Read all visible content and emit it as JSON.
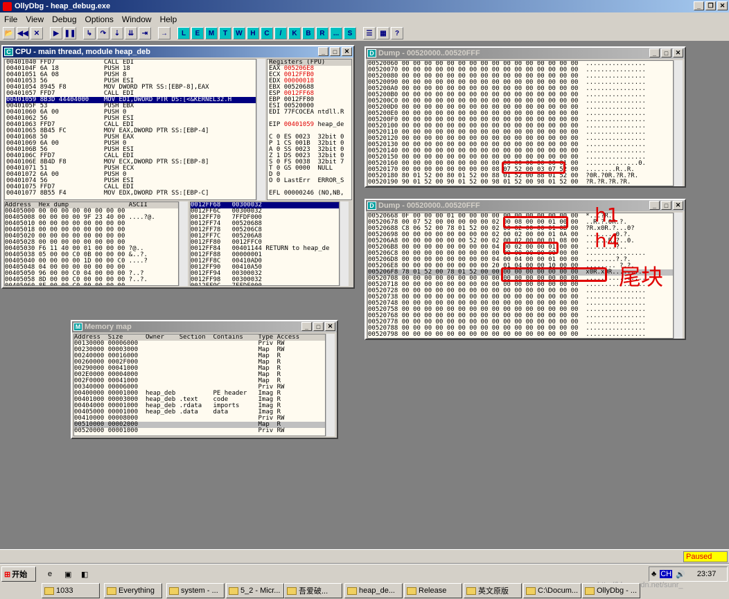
{
  "app": {
    "title": "OllyDbg - heap_debug.exe",
    "paused": "Paused"
  },
  "menu": [
    "File",
    "View",
    "Debug",
    "Options",
    "Window",
    "Help"
  ],
  "letters": [
    "L",
    "E",
    "M",
    "T",
    "W",
    "H",
    "C",
    "/",
    "K",
    "B",
    "R",
    "...",
    "S"
  ],
  "cpu": {
    "title": "CPU - main thread, module heap_deb",
    "disasm": [
      [
        "00401040",
        "FFD7",
        "CALL EDI"
      ],
      [
        "0040104F",
        "6A 18",
        "PUSH 18"
      ],
      [
        "00401051",
        "6A 08",
        "PUSH 8"
      ],
      [
        "00401053",
        "56",
        "PUSH ESI"
      ],
      [
        "00401054",
        "8945 F8",
        "MOV DWORD PTR SS:[EBP-8],EAX"
      ],
      [
        "00401057",
        "FFD7",
        "CALL EDI"
      ],
      [
        "00401059",
        "8B3D 44404000",
        "MOV EDI,DWORD PTR DS:[<&KERNEL32.H"
      ],
      [
        "0040105F",
        "53",
        "PUSH EBX"
      ],
      [
        "00401060",
        "6A 00",
        "PUSH 0"
      ],
      [
        "00401062",
        "56",
        "PUSH ESI"
      ],
      [
        "00401063",
        "FFD7",
        "CALL EDI"
      ],
      [
        "00401065",
        "8B45 FC",
        "MOV EAX,DWORD PTR SS:[EBP-4]"
      ],
      [
        "00401068",
        "50",
        "PUSH EAX"
      ],
      [
        "00401069",
        "6A 00",
        "PUSH 0"
      ],
      [
        "0040106B",
        "56",
        "PUSH ESI"
      ],
      [
        "0040106C",
        "FFD7",
        "CALL EDI"
      ],
      [
        "0040106E",
        "8B4D F8",
        "MOV ECX,DWORD PTR SS:[EBP-8]"
      ],
      [
        "00401071",
        "51",
        "PUSH ECX"
      ],
      [
        "00401072",
        "6A 00",
        "PUSH 0"
      ],
      [
        "00401074",
        "56",
        "PUSH ESI"
      ],
      [
        "00401075",
        "FFD7",
        "CALL EDI"
      ],
      [
        "00401077",
        "8B55 F4",
        "MOV EDX,DWORD PTR SS:[EBP-C]"
      ]
    ],
    "registers_title": "Registers (FPU)",
    "registers": [
      [
        "EAX",
        "005206E8",
        ""
      ],
      [
        "ECX",
        "0012FFB0",
        ""
      ],
      [
        "EDX",
        "00000018",
        ""
      ],
      [
        "EBX",
        "00520688",
        ""
      ],
      [
        "ESP",
        "0012FF68",
        ""
      ],
      [
        "EBP",
        "0012FF80",
        ""
      ],
      [
        "ESI",
        "00520000",
        ""
      ],
      [
        "EDI",
        "77FCOCEA",
        "ntdll.R"
      ],
      [
        "",
        "",
        " "
      ],
      [
        "EIP",
        "00401059",
        "heap_de"
      ],
      [
        "",
        "",
        " "
      ],
      [
        "C 0",
        "ES 0023",
        "32bit 0"
      ],
      [
        "P 1",
        "CS 001B",
        "32bit 0"
      ],
      [
        "A 0",
        "SS 0023",
        "32bit 0"
      ],
      [
        "Z 1",
        "DS 0023",
        "32bit 0"
      ],
      [
        "S 0",
        "FS 0038",
        "32bit 7"
      ],
      [
        "T 0",
        "GS 0000",
        "NULL"
      ],
      [
        "D 0",
        "",
        ""
      ],
      [
        "O 0",
        "LastErr",
        "ERROR_S"
      ],
      [
        "",
        "",
        " "
      ],
      [
        "EFL",
        "00000246",
        "(NO,NB,"
      ],
      [
        "",
        "",
        " "
      ],
      [
        "ST0",
        "empty",
        "+UNORM 006"
      ]
    ],
    "dump_headers": [
      "Address",
      "Hex dump",
      "ASCII"
    ],
    "dump": [
      [
        "00405000",
        "00 00 00 00 00 00 00 00",
        ""
      ],
      [
        "00405008",
        "00 00 00 00 9F 23 40 00",
        "....?@."
      ],
      [
        "00405010",
        "00 00 00 00 00 00 00 00",
        ""
      ],
      [
        "00405018",
        "00 00 00 00 00 00 00 00",
        ""
      ],
      [
        "00405020",
        "00 00 00 00 00 00 00 00",
        ""
      ],
      [
        "00405028",
        "00 00 00 00 00 00 00 00",
        ""
      ],
      [
        "00405030",
        "F6 11 40 00 01 00 00 00",
        "?@.."
      ],
      [
        "00405038",
        "05 00 00 C0 0B 00 00 00",
        "&..?."
      ],
      [
        "00405040",
        "00 00 00 00 1D 00 00 C0",
        "....?"
      ],
      [
        "00405048",
        "04 00 00 00 00 00 00 00",
        ""
      ],
      [
        "00405050",
        "96 00 00 C0 04 00 00 00",
        "?..?"
      ],
      [
        "00405058",
        "8D 00 00 C0 00 00 00 00",
        "?..?."
      ],
      [
        "00405060",
        "8E 00 00 C0 00 00 00 00",
        ""
      ]
    ],
    "stack": [
      [
        "0012FF68",
        "00300032",
        ""
      ],
      [
        "0012FF6C",
        "00300032",
        ""
      ],
      [
        "0012FF70",
        "7FFDF000",
        ""
      ],
      [
        "0012FF74",
        "00520688",
        ""
      ],
      [
        "0012FF78",
        "005206C8",
        ""
      ],
      [
        "0012FF7C",
        "005206A8",
        ""
      ],
      [
        "0012FF80",
        "0012FFC0",
        ""
      ],
      [
        "0012FF84",
        "00401144",
        "RETURN to heap_de"
      ],
      [
        "0012FF88",
        "00000001",
        ""
      ],
      [
        "0012FF8C",
        "00410AD0",
        ""
      ],
      [
        "0012FF90",
        "00410A50",
        ""
      ],
      [
        "0012FF94",
        "00300032",
        ""
      ],
      [
        "0012FF98",
        "00300032",
        ""
      ],
      [
        "0012FF9C",
        "7FFDF000",
        ""
      ]
    ]
  },
  "dump1": {
    "title": "Dump - 00520000..00520FFF",
    "rows": [
      [
        "00520060",
        "00 00 00 00 00 00 00 00 00 00 00 00 00 00 00 00",
        "................"
      ],
      [
        "00520070",
        "00 00 00 00 00 00 00 00 00 00 00 00 00 00 00 00",
        "................"
      ],
      [
        "00520080",
        "00 00 00 00 00 00 00 00 00 00 00 00 00 00 00 00",
        "................"
      ],
      [
        "00520090",
        "00 00 00 00 00 00 00 00 00 00 00 00 00 00 00 00",
        "................"
      ],
      [
        "005200A0",
        "00 00 00 00 00 00 00 00 00 00 00 00 00 00 00 00",
        "................"
      ],
      [
        "005200B0",
        "00 00 00 00 00 00 00 00 00 00 00 00 00 00 00 00",
        "................"
      ],
      [
        "005200C0",
        "00 00 00 00 00 00 00 00 00 00 00 00 00 00 00 00",
        "................"
      ],
      [
        "005200D0",
        "00 00 00 00 00 00 00 00 00 00 00 00 00 00 00 00",
        "................"
      ],
      [
        "005200E0",
        "00 00 00 00 00 00 00 00 00 00 00 00 00 00 00 00",
        "................"
      ],
      [
        "005200F0",
        "00 00 00 00 00 00 00 00 00 00 00 00 00 00 00 00",
        "................"
      ],
      [
        "00520100",
        "00 00 00 00 00 00 00 00 00 00 00 00 00 00 00 00",
        "................"
      ],
      [
        "00520110",
        "00 00 00 00 00 00 00 00 00 00 00 00 00 00 00 00",
        "................"
      ],
      [
        "00520120",
        "00 00 00 00 00 00 00 00 00 00 00 00 00 00 00 00",
        "................"
      ],
      [
        "00520130",
        "00 00 00 00 00 00 00 00 00 00 00 00 00 00 00 00",
        "................"
      ],
      [
        "00520140",
        "00 00 00 00 00 00 00 00 00 00 00 00 00 00 00 00",
        "................"
      ],
      [
        "00520150",
        "00 00 00 00 00 00 00 00 00 00 00 00 00 00 00 00",
        "................"
      ],
      [
        "00520160",
        "00 00 00 00 00 00 00 00 00 00 00 00 00 00 01 00",
        "..............0."
      ],
      [
        "00520170",
        "00 00 00 00 00 00 00 00 08 07 52 00 03 07 52 00",
        "........R..R."
      ],
      [
        "00520180",
        "80 01 52 00 80 01 52 00 88 01 52 00 88 01 52 00",
        "?0R.?0R.?R.?R."
      ],
      [
        "00520190",
        "90 01 52 00 90 01 52 00 98 01 52 00 98 01 52 00",
        "?R.?R.?R.?R."
      ]
    ]
  },
  "dump2": {
    "title": "Dump - 00520000..00520FFF",
    "rows": [
      [
        "00520668",
        "0F 00 00 00 01 00 00 00 00 00 00 00 00 00 00 00",
        "*...?R."
      ],
      [
        "00520678",
        "00 07 52 00 00 00 00 00 02 00 08 00 00 01 00 00",
        "..R.?.0R.?."
      ],
      [
        "00520688",
        "C8 06 52 00 78 01 52 00 02 00 02 00 00 01 0B 00",
        "?R.x0R.?...0?"
      ],
      [
        "00520698",
        "00 00 00 00 00 00 00 00 02 00 02 00 00 01 0A 00",
        "........0.?."
      ],
      [
        "005206A8",
        "00 00 00 00 00 00 52 00 02 00 02 00 00 01 08 00",
        "......R.?..0."
      ],
      [
        "005206B8",
        "00 00 00 00 00 00 00 00 04 00 02 00 00 01 00 00",
        "........?.."
      ],
      [
        "005206C8",
        "00 00 00 00 00 00 00 00 00 00 00 00 00 00 00 00",
        "................"
      ],
      [
        "005206D8",
        "00 00 00 00 00 00 00 00 04 00 04 00 00 01 00 00",
        "........?.?."
      ],
      [
        "005206E8",
        "00 00 00 00 00 00 00 00 20 01 04 00 00 10 00 00",
        "........ ?.?."
      ],
      [
        "005206F8",
        "78 01 52 00 78 01 52 00 00 00 00 00 00 00 00 00",
        "x0R.x0R........."
      ],
      [
        "00520708",
        "00 00 00 00 00 00 00 00 00 00 00 00 00 00 00 00",
        "................"
      ],
      [
        "00520718",
        "00 00 00 00 00 00 00 00 00 00 00 00 00 00 00 00",
        "................"
      ],
      [
        "00520728",
        "00 00 00 00 00 00 00 00 00 00 00 00 00 00 00 00",
        "................"
      ],
      [
        "00520738",
        "00 00 00 00 00 00 00 00 00 00 00 00 00 00 00 00",
        "................"
      ],
      [
        "00520748",
        "00 00 00 00 00 00 00 00 00 00 00 00 00 00 00 00",
        "................"
      ],
      [
        "00520758",
        "00 00 00 00 00 00 00 00 00 00 00 00 00 00 00 00",
        "................"
      ],
      [
        "00520768",
        "00 00 00 00 00 00 00 00 00 00 00 00 00 00 00 00",
        "................"
      ],
      [
        "00520778",
        "00 00 00 00 00 00 00 00 00 00 00 00 00 00 00 00",
        "................"
      ],
      [
        "00520788",
        "00 00 00 00 00 00 00 00 00 00 00 00 00 00 00 00",
        "................"
      ],
      [
        "00520798",
        "00 00 00 00 00 00 00 00 00 00 00 00 00 00 00 00",
        "................"
      ]
    ],
    "annotations": {
      "h1": "h1",
      "h4": "h4",
      "tail": "尾块"
    }
  },
  "memmap": {
    "title": "Memory map",
    "headers": [
      "Address",
      "Size",
      "Owner",
      "Section",
      "Contains",
      "Type",
      "Access"
    ],
    "rows": [
      [
        "00130000",
        "00006000",
        "",
        "",
        "",
        "Priv",
        "RW"
      ],
      [
        "00230000",
        "00003000",
        "",
        "",
        "",
        "Map",
        "RW"
      ],
      [
        "00240000",
        "00016000",
        "",
        "",
        "",
        "Map",
        "R"
      ],
      [
        "00260000",
        "0002F000",
        "",
        "",
        "",
        "Map",
        "R"
      ],
      [
        "00290000",
        "00041000",
        "",
        "",
        "",
        "Map",
        "R"
      ],
      [
        "002E0000",
        "00004000",
        "",
        "",
        "",
        "Map",
        "R"
      ],
      [
        "002F0000",
        "00041000",
        "",
        "",
        "",
        "Map",
        "R"
      ],
      [
        "00340000",
        "00006000",
        "",
        "",
        "",
        "Priv",
        "RW"
      ],
      [
        "00400000",
        "00001000",
        "heap_deb",
        "",
        "PE header",
        "Imag",
        "R"
      ],
      [
        "00401000",
        "00003000",
        "heap_deb",
        ".text",
        "code",
        "Imag",
        "R"
      ],
      [
        "00404000",
        "00001000",
        "heap_deb",
        ".rdata",
        "imports",
        "Imag",
        "R"
      ],
      [
        "00405000",
        "00001000",
        "heap_deb",
        ".data",
        "data",
        "Imag",
        "R"
      ],
      [
        "00410000",
        "00008000",
        "",
        "",
        "",
        "Priv",
        "RW"
      ],
      [
        "00510000",
        "00002000",
        "",
        "",
        "",
        "Map",
        "R"
      ],
      [
        "00520000",
        "00001000",
        "",
        "",
        "",
        "Priv",
        "RW"
      ]
    ]
  },
  "taskbar": {
    "start": "开始",
    "items": [
      "1033",
      "Everything",
      "system - ...",
      "5_2 - Micr...",
      "吾爱破...",
      "heap_de...",
      "Release",
      "英文原版",
      "C:\\Docum...",
      "OllyDbg - ..."
    ],
    "tray": {
      "lang": "CH",
      "time": "23:37",
      "watermark": "http://blog.csdn.net/sunr_"
    }
  }
}
